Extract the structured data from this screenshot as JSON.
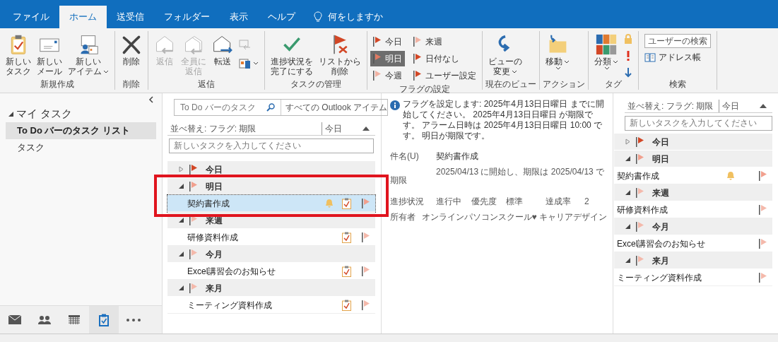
{
  "tabs": [
    {
      "label": "ファイル",
      "selected": false
    },
    {
      "label": "ホーム",
      "selected": true
    },
    {
      "label": "送受信",
      "selected": false
    },
    {
      "label": "フォルダー",
      "selected": false
    },
    {
      "label": "表示",
      "selected": false
    },
    {
      "label": "ヘルプ",
      "selected": false
    }
  ],
  "tell_me": "何をしますか",
  "ribbon": [
    {
      "label": "新規作成",
      "buttons": [
        {
          "kind": "large",
          "lines": [
            "新しい",
            "タスク"
          ],
          "disabled": false,
          "dropdown": false
        },
        {
          "kind": "large",
          "lines": [
            "新しい",
            "メール"
          ],
          "disabled": false,
          "dropdown": false
        },
        {
          "kind": "large",
          "lines": [
            "新しい",
            "アイテム"
          ],
          "disabled": false,
          "dropdown": true
        }
      ]
    },
    {
      "label": "削除",
      "buttons": [
        {
          "kind": "large",
          "lines": [
            "削除"
          ],
          "disabled": false,
          "dropdown": false
        }
      ]
    },
    {
      "label": "返信",
      "buttons": [
        {
          "kind": "large",
          "lines": [
            "返信"
          ],
          "disabled": true,
          "dropdown": false
        },
        {
          "kind": "large",
          "lines": [
            "全員に",
            "返信"
          ],
          "disabled": true,
          "dropdown": false
        },
        {
          "kind": "large",
          "lines": [
            "転送"
          ],
          "disabled": false,
          "dropdown": false
        },
        {
          "kind": "icons",
          "disabled": true,
          "dropdown": true
        }
      ]
    },
    {
      "label": "タスクの管理",
      "buttons": [
        {
          "kind": "large",
          "lines": [
            "進捗状況を",
            "完了にする"
          ],
          "disabled": false,
          "dropdown": false
        },
        {
          "kind": "large",
          "lines": [
            "リストから",
            "削除"
          ],
          "disabled": false,
          "dropdown": false
        }
      ]
    },
    {
      "label": "フラグの設定",
      "buttons": [
        {
          "kind": "flags",
          "flags": [
            {
              "label": "今日",
              "color": "#d24726",
              "selected": false
            },
            {
              "label": "明日",
              "color": "#e07a62",
              "selected": true
            },
            {
              "label": "今週",
              "color": "#f1b2a3",
              "selected": false
            },
            {
              "label": "来週",
              "color": "#f1b2a3",
              "selected": false
            },
            {
              "label": "日付なし",
              "color": "#d24726",
              "selected": false
            },
            {
              "label": "ユーザー設定",
              "color": "#d24726",
              "selected": false
            }
          ]
        }
      ]
    },
    {
      "label": "現在のビュー",
      "buttons": [
        {
          "kind": "large",
          "lines": [
            "ビューの",
            "変更"
          ],
          "disabled": false,
          "dropdown": true
        }
      ]
    },
    {
      "label": "アクション",
      "buttons": [
        {
          "kind": "large",
          "lines": [
            "移動"
          ],
          "disabled": false,
          "dropdown": true
        }
      ]
    },
    {
      "label": "タグ",
      "buttons": [
        {
          "kind": "large",
          "lines": [
            "分類"
          ],
          "disabled": false,
          "dropdown": true
        },
        {
          "kind": "icons",
          "disabled": false
        }
      ]
    },
    {
      "label": "検索",
      "buttons": [
        {
          "kind": "search",
          "text": "ユーザーの検索"
        },
        {
          "kind": "link",
          "text": "アドレス帳"
        }
      ]
    }
  ],
  "nav": {
    "folder": "マイ タスク",
    "expanded": true,
    "items": [
      {
        "label": "To Do バーのタスク リスト",
        "selected": true
      },
      {
        "label": "タスク",
        "selected": false
      }
    ]
  },
  "task_list": {
    "search_placeholder": "To Do バーのタスク",
    "scope": "すべての Outlook アイテム",
    "sort": "並べ替え: フラグ: 期限",
    "sort_value": "今日",
    "new_task_placeholder": "新しいタスクを入力してください",
    "groups": [
      {
        "label": "今日",
        "expanded": false,
        "color": "#d24726"
      },
      {
        "label": "明日",
        "expanded": true,
        "color": "#f1a08e",
        "tasks": [
          {
            "subject": "契約書作成",
            "selected": true,
            "reminder": true
          }
        ]
      },
      {
        "label": "来週",
        "expanded": true,
        "color": "#f4b9ab",
        "tasks": [
          {
            "subject": "研修資料作成",
            "selected": false,
            "reminder": false
          }
        ]
      },
      {
        "label": "今月",
        "expanded": true,
        "color": "#f4b9ab",
        "tasks": [
          {
            "subject": "Excel講習会のお知らせ",
            "selected": false,
            "reminder": false
          }
        ]
      },
      {
        "label": "来月",
        "expanded": true,
        "color": "#f4b9ab",
        "tasks": [
          {
            "subject": "ミーティング資料作成",
            "selected": false,
            "reminder": false
          }
        ]
      }
    ]
  },
  "reading": {
    "info": "フラグを設定します:  2025年4月13日日曜日 までに開始してください。 2025年4月13日日曜日 が期限です。 アラーム日時は 2025年4月13日日曜日 10:00 です。 明日が期限です。",
    "subject_label": "件名(U)",
    "subject": "契約書作成",
    "due_label": "期限",
    "due": "2025/04/13 に開始し、期限は 2025/04/13 で",
    "status_label": "進捗状況",
    "status": "進行中",
    "priority_label": "優先度",
    "priority": "標準",
    "complete_label": "達成率",
    "complete": "2",
    "owner_label": "所有者",
    "owner": "オンラインパソコンスクール♥ キャリアデザイン"
  },
  "todo_bar": {
    "sort": "並べ替え: フラグ: 期限",
    "sort_value": "今日",
    "new_task_placeholder": "新しいタスクを入力してください",
    "groups": [
      {
        "label": "今日",
        "expanded": false,
        "color": "#d24726"
      },
      {
        "label": "明日",
        "expanded": true,
        "color": "#f1a08e",
        "tasks": [
          {
            "subject": "契約書作成",
            "reminder": true
          }
        ]
      },
      {
        "label": "来週",
        "expanded": true,
        "color": "#f4b9ab",
        "tasks": [
          {
            "subject": "研修資料作成",
            "reminder": false
          }
        ]
      },
      {
        "label": "今月",
        "expanded": true,
        "color": "#f4b9ab",
        "tasks": [
          {
            "subject": "Excel講習会のお知らせ",
            "reminder": false
          }
        ]
      },
      {
        "label": "来月",
        "expanded": true,
        "color": "#f4b9ab",
        "tasks": [
          {
            "subject": "ミーティング資料作成",
            "reminder": false
          }
        ]
      }
    ]
  },
  "bottom_nav": [
    {
      "selected": false
    },
    {
      "selected": false
    },
    {
      "selected": false
    },
    {
      "selected": true
    },
    {
      "selected": false
    }
  ]
}
